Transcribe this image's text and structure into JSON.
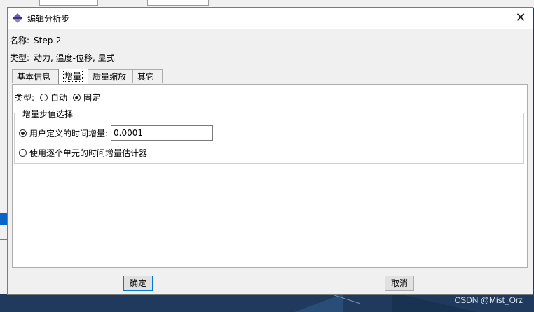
{
  "dialog": {
    "title": "编辑分析步",
    "close_glyph": "✕",
    "name_label": "名称:",
    "name_value": "Step-2",
    "type_label": "类型:",
    "type_value": "动力, 温度-位移, 显式"
  },
  "tabs": [
    {
      "label": "基本信息",
      "active": false
    },
    {
      "label": "增量",
      "active": true
    },
    {
      "label": "质量缩放",
      "active": false
    },
    {
      "label": "其它",
      "active": false
    }
  ],
  "increment": {
    "type_label": "类型:",
    "type_options": [
      {
        "label": "自动",
        "selected": false
      },
      {
        "label": "固定",
        "selected": true
      }
    ],
    "group_title": "增量步值选择",
    "user_defined_label": "用户定义的时间增量:",
    "user_defined_selected": true,
    "user_defined_value": "0.0001",
    "element_estimator_label": "使用逐个单元的时间增量估计器",
    "element_estimator_selected": false
  },
  "buttons": {
    "ok": "确定",
    "cancel": "取消"
  },
  "watermark": "CSDN @Mist_Orz",
  "colors": {
    "title_icon": "#6a5fb0",
    "focus_border": "#0078d7",
    "desktop": "#1f3a5c"
  }
}
